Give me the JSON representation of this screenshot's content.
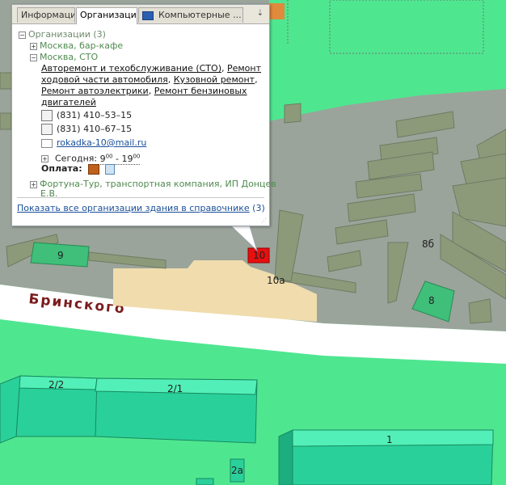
{
  "colors": {
    "grass": "#4fe690",
    "asphalt": "#9aa49a",
    "building": "#8d9a7a",
    "accent_building": "#e80f0f",
    "sand": "#f0dcad"
  },
  "map": {
    "street_name": "Бринского",
    "house_labels": {
      "h9": "9",
      "h10b": "10",
      "h10a": "10а",
      "h8b": "8б",
      "h8": "8",
      "h22": "2/2",
      "h21": "2/1",
      "h1": "1",
      "h2a": "2а"
    }
  },
  "popup": {
    "tabs": [
      {
        "label": "Информация"
      },
      {
        "label": "Организации"
      },
      {
        "label": "Компьютерные ...",
        "icon": "monitor-icon"
      }
    ],
    "tree": {
      "root": "Организации (3)",
      "group1": "Москва, бар-кафе",
      "group2": "Москва, СТО",
      "services_line1_a": "Авторемонт и техобслуживание (СТО)",
      "services_line1_b": "Ремонт",
      "services_line2_a": "ходовой части автомобиля",
      "services_line2_b": "Кузовной ремонт",
      "services_line3_a": "Ремонт автоэлектрики",
      "services_line3_b": "Ремонт бензиновых",
      "services_line4": "двигателей",
      "phone1": "(831) 410–53–15",
      "phone2": "(831) 410–67–15",
      "email": "rokadka-10@mail.ru",
      "hours_label": "Сегодня:",
      "hours_from": "9",
      "hours_from_min": "00",
      "hours_to": "19",
      "hours_to_min": "00",
      "payment_label": "Оплата:",
      "group3_line1": "Фортуна-Тур, транспортная компания, ИП Донцев",
      "group3_line2": "Е.В."
    },
    "footer_link": "Показать все организации здания в справочнике",
    "footer_count": "(3)"
  }
}
